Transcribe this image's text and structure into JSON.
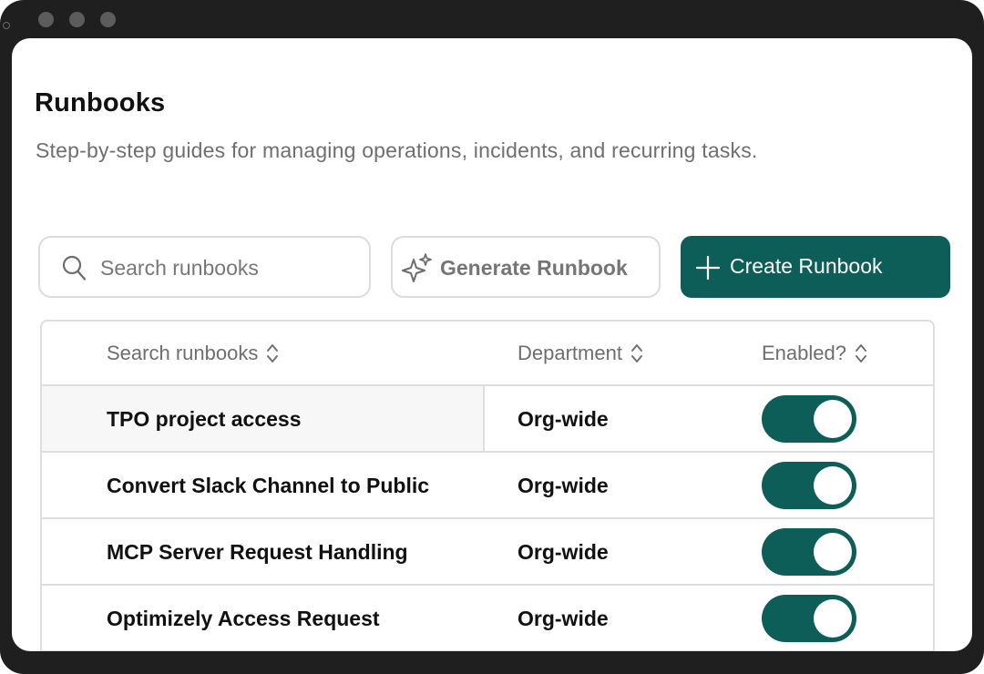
{
  "header": {
    "title": "Runbooks",
    "subtitle": "Step-by-step guides for managing operations, incidents, and recurring tasks."
  },
  "toolbar": {
    "search_placeholder": "Search runbooks",
    "generate_label": "Generate Runbook",
    "create_label": "Create Runbook"
  },
  "table": {
    "columns": [
      "Search runbooks",
      "Department",
      "Enabled?"
    ],
    "rows": [
      {
        "name": "TPO project access",
        "department": "Org-wide",
        "enabled": true
      },
      {
        "name": "Convert Slack Channel to Public",
        "department": "Org-wide",
        "enabled": true
      },
      {
        "name": "MCP Server Request Handling",
        "department": "Org-wide",
        "enabled": true
      },
      {
        "name": "Optimizely Access Request",
        "department": "Org-wide",
        "enabled": true
      }
    ]
  },
  "colors": {
    "accent": "#0d5e58",
    "frame": "#1f1f1f",
    "border": "#dedede",
    "muted_text": "#6f6f6f"
  },
  "icons": {
    "search": "search-icon",
    "generate": "sparkle-icon",
    "create": "plus-icon",
    "sort": "sort-icon"
  }
}
